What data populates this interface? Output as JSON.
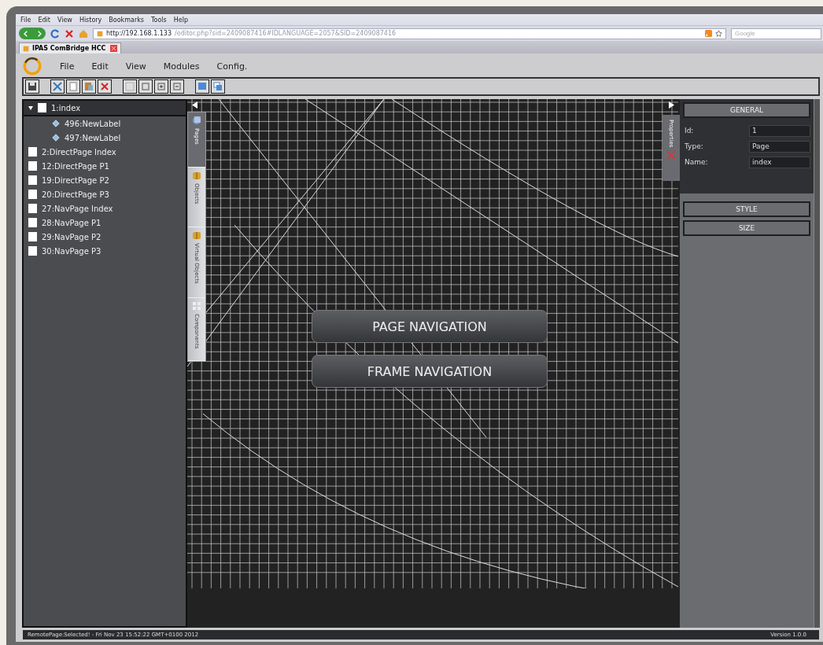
{
  "browser": {
    "menu": [
      "File",
      "Edit",
      "View",
      "History",
      "Bookmarks",
      "Tools",
      "Help"
    ],
    "url_host": "http://192.168.1.133",
    "url_path": "/editor.php?sid=2409087416#IDLANGUAGE=2057&SID=2409087416",
    "search": {
      "placeholder": "Google"
    },
    "tabs": [
      {
        "title": "IPAS ComBridge HCC",
        "selected": true
      }
    ]
  },
  "app_menu": [
    "File",
    "Edit",
    "View",
    "Modules",
    "Config."
  ],
  "tree": [
    {
      "label": "1:index",
      "kind": "page",
      "checked": false,
      "expanded": true,
      "children": [
        {
          "label": "496:NewLabel",
          "kind": "label"
        },
        {
          "label": "497:NewLabel",
          "kind": "label"
        }
      ]
    },
    {
      "label": "2:DirectPage Index",
      "kind": "page",
      "checked": false
    },
    {
      "label": "12:DirectPage P1",
      "kind": "page",
      "checked": false
    },
    {
      "label": "19:DirectPage P2",
      "kind": "page",
      "checked": false
    },
    {
      "label": "20:DirectPage P3",
      "kind": "page",
      "checked": false
    },
    {
      "label": "27:NavPage Index",
      "kind": "page",
      "checked": false
    },
    {
      "label": "28:NavPage P1",
      "kind": "page",
      "checked": false
    },
    {
      "label": "29:NavPage P2",
      "kind": "page",
      "checked": false
    },
    {
      "label": "30:NavPage P3",
      "kind": "page",
      "checked": false
    }
  ],
  "side_tabs": [
    {
      "label": "Pages",
      "kind": "globe",
      "selected": true
    },
    {
      "label": "Objects",
      "kind": "box",
      "selected": false
    },
    {
      "label": "Virtual Objects",
      "kind": "box",
      "selected": false
    },
    {
      "label": "Components",
      "kind": "dots",
      "selected": false
    }
  ],
  "canvas_buttons": [
    "PAGE NAVIGATION",
    "FRAME NAVIGATION"
  ],
  "properties_tab": "Properties",
  "sections": [
    {
      "title": "GENERAL",
      "fields": [
        {
          "label": "Id:",
          "value": "1"
        },
        {
          "label": "Type:",
          "value": "Page"
        },
        {
          "label": "Name:",
          "value": "index"
        }
      ]
    },
    {
      "title": "STYLE"
    },
    {
      "title": "SIZE"
    }
  ],
  "status": {
    "message": "RemotePage:Selected! - Fri Nov 23 15:52:22 GMT+0100 2012",
    "version": "Version 1.0.0"
  }
}
